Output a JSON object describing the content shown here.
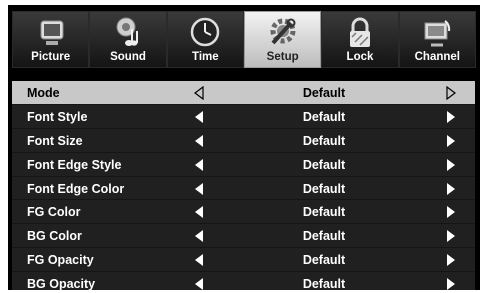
{
  "tabs": [
    {
      "label": "Picture",
      "icon": "tv-icon",
      "active": false
    },
    {
      "label": "Sound",
      "icon": "music-note-icon",
      "active": false
    },
    {
      "label": "Time",
      "icon": "clock-icon",
      "active": false
    },
    {
      "label": "Setup",
      "icon": "wrench-gear-icon",
      "active": true
    },
    {
      "label": "Lock",
      "icon": "padlock-icon",
      "active": false
    },
    {
      "label": "Channel",
      "icon": "satellite-dish-icon",
      "active": false
    }
  ],
  "rows": [
    {
      "name": "Mode",
      "value": "Default"
    },
    {
      "name": "Font Style",
      "value": "Default"
    },
    {
      "name": "Font Size",
      "value": "Default"
    },
    {
      "name": "Font Edge Style",
      "value": "Default"
    },
    {
      "name": "Font Edge Color",
      "value": "Default"
    },
    {
      "name": "FG Color",
      "value": "Default"
    },
    {
      "name": "BG Color",
      "value": "Default"
    },
    {
      "name": "FG Opacity",
      "value": "Default"
    },
    {
      "name": "BG Opacity",
      "value": "Default"
    }
  ],
  "selected_row": "Mode",
  "colors": {
    "selected_row_bg": "#c8c8c8",
    "menu_bg": "#202020",
    "active_tab": "#e6e6e6"
  }
}
